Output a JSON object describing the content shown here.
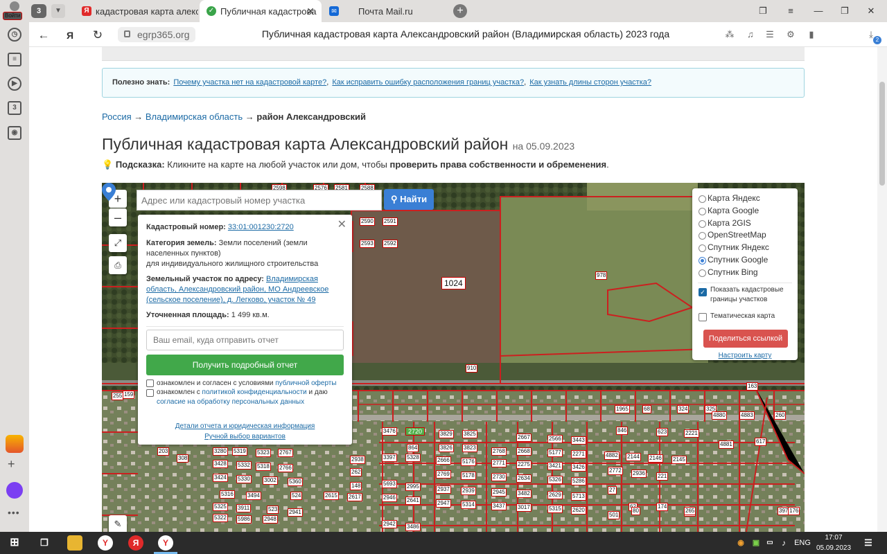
{
  "browser": {
    "profile_label": "Войти",
    "tab_count": "3",
    "tabs": [
      {
        "title": "кадастровая карта алекса"
      },
      {
        "title": "Публичная кадастрова"
      },
      {
        "title": "Почта Mail.ru"
      }
    ],
    "url": "egrp365.org",
    "page_title": "Публичная кадастровая карта Александровский район (Владимирская область) 2023 года",
    "downloads_badge": "2",
    "extension_badge": "1",
    "sidebar_badge": "3"
  },
  "colors": {
    "accent": "#3a7fd5",
    "green": "#41a84a",
    "red": "#d9534f",
    "parcel_border": "#cc1f1f"
  },
  "info": {
    "label": "Полезно знать:",
    "links": [
      "Почему участка нет на кадастровой карте?",
      "Как исправить ошибку расположения границ участка?",
      "Как узнать длины сторон участка?"
    ]
  },
  "breadcrumbs": {
    "items": [
      "Россия",
      "Владимирская область"
    ],
    "current": "район Александровский",
    "separator": "→"
  },
  "heading": {
    "title": "Публичная кадастровая карта Александровский район",
    "date": "на 05.09.2023"
  },
  "hint": {
    "label": "Подсказка:",
    "text": "Кликните на карте на любой участок или дом, чтобы",
    "bold": "проверить права собственности и обременения",
    "end": "."
  },
  "map": {
    "zoom_in": "+",
    "zoom_out": "–",
    "search_placeholder": "Адрес или кадастровый номер участка",
    "search_button": "Найти",
    "popup": {
      "cad_label": "Кадастровый номер:",
      "cad_number": "33:01:001230:2720",
      "cat_label": "Категория земель:",
      "cat_value": "Земли поселений (земли",
      "cat_value2": "населенных пунктов)",
      "cat_value3": "для индивидуального жилищного строительства",
      "addr_label": "Земельный участок по адресу:",
      "addr_value": "Владимирская",
      "addr_value2": "область, Александровский район, МО Андреевское",
      "addr_value3": "(сельское поселение), д. Легково, участок № 49",
      "area_label": "Уточненная площадь:",
      "area_value": "1 499 кв.м.",
      "email_placeholder": "Ваш email, куда отправить отчет",
      "report_button": "Получить подробный отчет",
      "agree1_text": "ознакомлен и согласен с условиями",
      "agree1_link": "публичной оферты",
      "agree2_text": "ознакомлен с",
      "agree2_link": "политикой конфиденциальности",
      "agree2_text2": "и даю",
      "agree2_link2": "согласие на обработку персональных данных",
      "details_link": "Детали отчета и юридическая информация",
      "manual_link": "Ручной выбор вариантов"
    },
    "layers": {
      "options": [
        "Карта Яндекс",
        "Карта Google",
        "Карта 2GIS",
        "OpenStreetMap",
        "Спутник Яндекс",
        "Спутник Google",
        "Спутник Bing"
      ],
      "selected": "Спутник Google",
      "show_borders": "Показать кадастровые",
      "show_borders2": "границы участков",
      "thematic": "Тематическая карта",
      "share_button": "Поделиться ссылкой",
      "configure_link": "Настроить карту"
    },
    "parcel_labels": [
      "2598",
      "2576",
      "2581",
      "2588",
      "2590",
      "2591",
      "2593",
      "2592",
      "1024",
      "978",
      "910",
      "2720",
      "3476",
      "3829",
      "3825",
      "2667",
      "2566",
      "3443",
      "3826",
      "3823",
      "2768",
      "2668",
      "5177",
      "2271",
      "3397",
      "5328",
      "2666",
      "5176",
      "2771",
      "2275",
      "3421",
      "3426",
      "2769",
      "5178",
      "2730",
      "2634",
      "5326",
      "5286",
      "5693",
      "2995",
      "2937",
      "2939",
      "2945",
      "3482",
      "2629",
      "5713",
      "2946",
      "2641",
      "2947",
      "5314",
      "3437",
      "3017",
      "5315",
      "2620",
      "2942",
      "3486",
      "3280",
      "5319",
      "5323",
      "2767",
      "3428",
      "5332",
      "5318",
      "2766",
      "3424",
      "5330",
      "3002",
      "5360",
      "5316",
      "3494",
      "524",
      "5325",
      "3911",
      "523",
      "5322",
      "5986",
      "2948",
      "2941",
      "2615",
      "2617",
      "2938",
      "262",
      "148",
      "864",
      "1965",
      "68",
      "324",
      "325",
      "846",
      "623",
      "2221",
      "4880",
      "4881",
      "4883",
      "4882",
      "2144",
      "2146",
      "2145",
      "2772",
      "2936",
      "221",
      "27",
      "62",
      "501",
      "80",
      "174",
      "677",
      "617",
      "397",
      "176",
      "163",
      "260",
      "265",
      "255",
      "159",
      "121",
      "285",
      "345",
      "457",
      "197",
      "203",
      "308"
    ]
  },
  "taskbar": {
    "lang": "ENG",
    "time": "17:07",
    "date": "05.09.2023"
  }
}
